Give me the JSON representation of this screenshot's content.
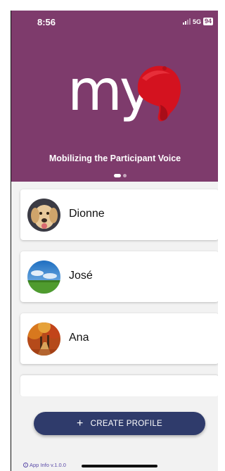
{
  "status_bar": {
    "time": "8:56",
    "network": "5G",
    "battery": "94",
    "icons": [
      "signal-icon",
      "battery-icon"
    ]
  },
  "header": {
    "logo_text": "my",
    "logo_icon": "red-cap-icon",
    "tagline": "Mobilizing the Participant Voice",
    "carousel_pages": 2,
    "carousel_active": 1
  },
  "profiles": [
    {
      "name": "Dionne",
      "avatar": "dog-photo"
    },
    {
      "name": "José",
      "avatar": "sky-field-photo"
    },
    {
      "name": "Ana",
      "avatar": "autumn-trees-photo"
    }
  ],
  "actions": {
    "create_profile_icon": "+",
    "create_profile_label": "CREATE PROFILE"
  },
  "footer": {
    "app_info_label": "App Info v.1.0.0",
    "info_icon": "info-icon"
  },
  "colors": {
    "brand": "#7e3b6c",
    "button": "#2f3b6b",
    "cap_red": "#d4121f"
  }
}
